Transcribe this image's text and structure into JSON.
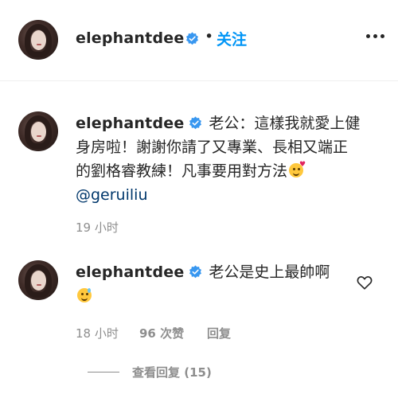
{
  "post_header": {
    "username": "elephantdee",
    "separator": "•",
    "follow_label": "关注",
    "more_icon": "more-horizontal-icon"
  },
  "comments": [
    {
      "username": "elephantdee",
      "text": "老公：這樣我就愛上健身房啦！謝謝你請了又專業、長相又端正的劉格睿教練！凡事要用對方法",
      "emoji": "face-blowing-kiss",
      "mention": "@geruiliu",
      "time": "19 小时"
    },
    {
      "username": "elephantdee",
      "text": "老公是史上最帥啊",
      "emoji": "grinning-face-with-sweat",
      "time": "18 小时",
      "likes": "96 次赞",
      "reply_label": "回复",
      "like_icon": "heart-outline-icon",
      "view_replies": "查看回复 (15)"
    }
  ],
  "colors": {
    "link_blue": "#0095f6",
    "mention": "#00376b",
    "muted": "#8e8e8e",
    "verified": "#3897f0"
  }
}
